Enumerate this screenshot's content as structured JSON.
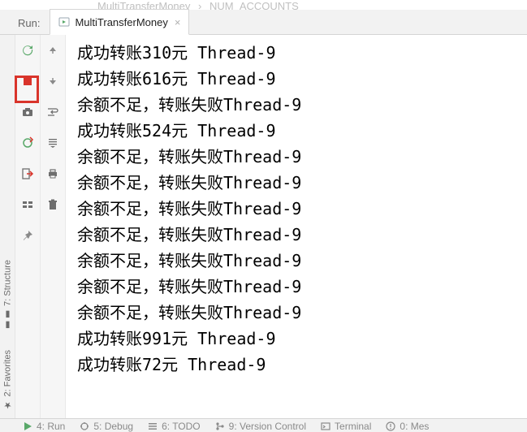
{
  "breadcrumb": {
    "item1": "MultiTransferMoney",
    "sep": "›",
    "item2": "NUM_ACCOUNTS"
  },
  "run_header": {
    "label": "Run:",
    "tab_label": "MultiTransferMoney"
  },
  "console_lines": [
    "成功转账310元 Thread-9",
    "成功转账616元 Thread-9",
    "余额不足，转账失败Thread-9",
    "成功转账524元 Thread-9",
    "余额不足，转账失败Thread-9",
    "余额不足，转账失败Thread-9",
    "余额不足，转账失败Thread-9",
    "余额不足，转账失败Thread-9",
    "余额不足，转账失败Thread-9",
    "余额不足，转账失败Thread-9",
    "余额不足，转账失败Thread-9",
    "成功转账991元 Thread-9",
    "成功转账72元 Thread-9"
  ],
  "side_rail": {
    "structure": "7: Structure",
    "favorites": "2: Favorites"
  },
  "bottom_bar": {
    "run": "4: Run",
    "debug": "5: Debug",
    "todo": "6: TODO",
    "vcs": "9: Version Control",
    "terminal": "Terminal",
    "messages": "0: Mes"
  }
}
